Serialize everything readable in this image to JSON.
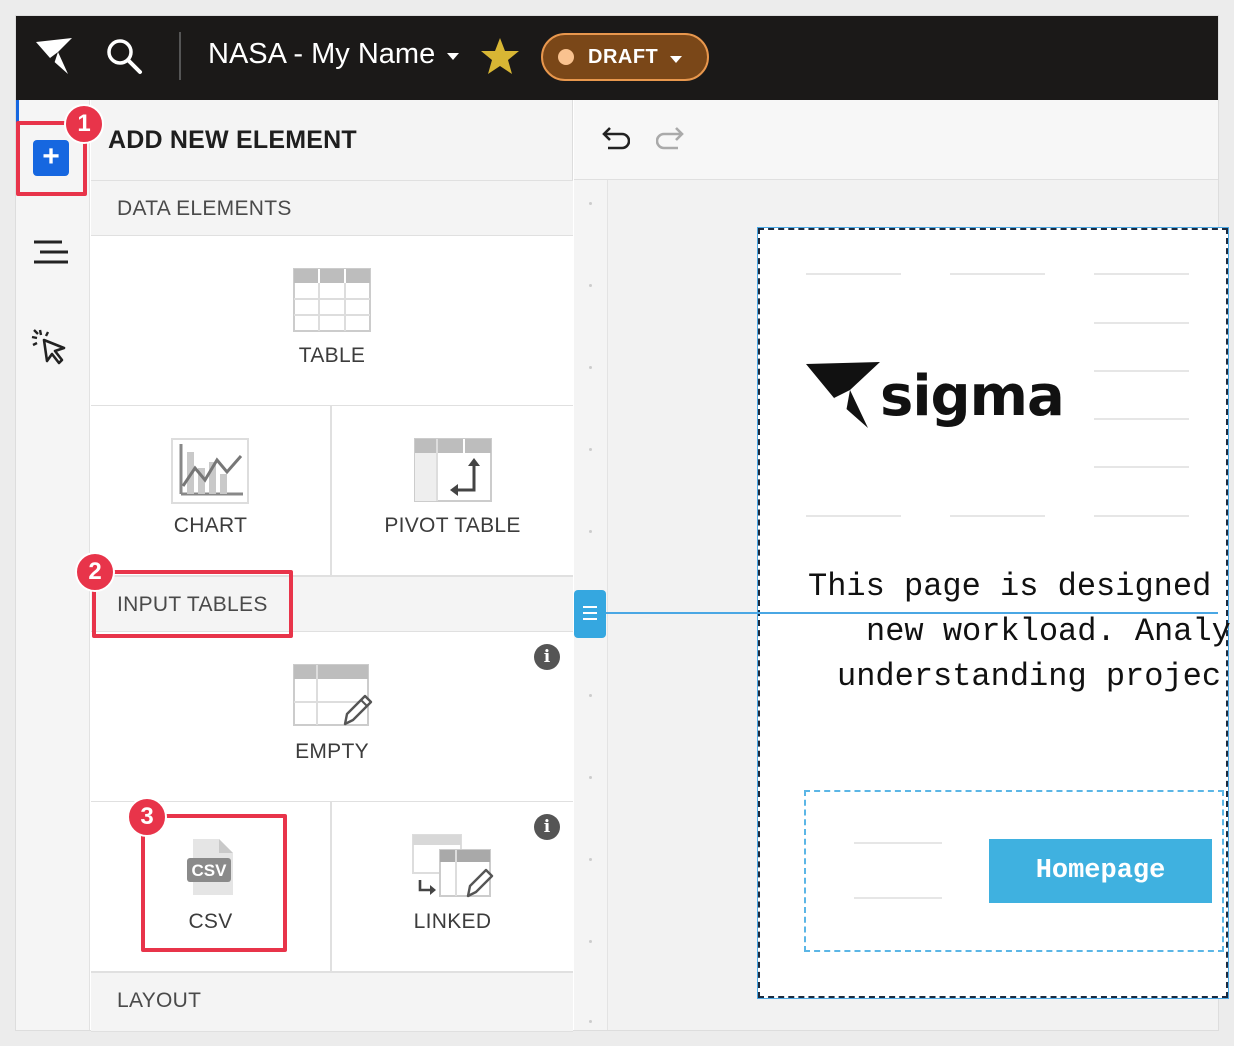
{
  "topbar": {
    "doc_name": "NASA - My Name",
    "status_label": "DRAFT",
    "colors": {
      "bar": "#1b1918",
      "draft_bg": "#7a4718",
      "draft_border": "#e8974d",
      "star": "#d8b634"
    }
  },
  "rail": {
    "add_symbol": "+",
    "accent": "#1667e0"
  },
  "panel": {
    "title": "ADD NEW ELEMENT",
    "sections": {
      "data": "DATA ELEMENTS",
      "input": "INPUT TABLES",
      "layout": "LAYOUT"
    },
    "tiles": {
      "table": "TABLE",
      "chart": "CHART",
      "pivot": "PIVOT TABLE",
      "empty": "EMPTY",
      "csv": "CSV",
      "linked": "LINKED"
    },
    "info_symbol": "i",
    "csv_icon_text": "CSV"
  },
  "canvas": {
    "brand": "sigma",
    "text_lines": [
      "This page is designed",
      "new workload. Analy",
      "understanding projec"
    ],
    "button_label": "Homepage",
    "button_color": "#3fb1e0"
  },
  "annotations": {
    "badges": [
      "1",
      "2",
      "3"
    ],
    "color": "#e8344a"
  }
}
